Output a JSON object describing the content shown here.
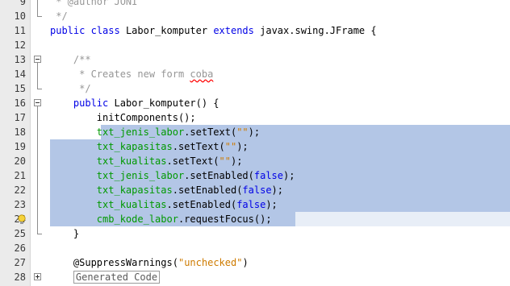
{
  "editor": {
    "line_numbers": [
      "9",
      "10",
      "11",
      "12",
      "13",
      "14",
      "15",
      "16",
      "17",
      "18",
      "19",
      "20",
      "21",
      "22",
      "23",
      "24",
      "25",
      "26",
      "27",
      "28"
    ],
    "lines": [
      [
        {
          "t": " * @author JONI",
          "c": "cmt"
        }
      ],
      [
        {
          "t": " */",
          "c": "cmt"
        }
      ],
      [
        {
          "t": "public",
          "c": "kw"
        },
        {
          "t": " ",
          "c": ""
        },
        {
          "t": "class",
          "c": "kw"
        },
        {
          "t": " Labor_komputer ",
          "c": ""
        },
        {
          "t": "extends",
          "c": "kw"
        },
        {
          "t": " javax.swing.JFrame {",
          "c": ""
        }
      ],
      [
        {
          "t": "",
          "c": ""
        }
      ],
      [
        {
          "t": "    /**",
          "c": "cmt"
        }
      ],
      [
        {
          "t": "     * Creates new form ",
          "c": "cmt"
        },
        {
          "t": "coba",
          "c": "cmt squiggle"
        }
      ],
      [
        {
          "t": "     */",
          "c": "cmt"
        }
      ],
      [
        {
          "t": "    ",
          "c": ""
        },
        {
          "t": "public",
          "c": "kw"
        },
        {
          "t": " Labor_komputer() {",
          "c": ""
        }
      ],
      [
        {
          "t": "        initComponents();",
          "c": ""
        }
      ],
      [
        {
          "t": "        ",
          "c": ""
        },
        {
          "t": "txt_jenis_labor",
          "c": "field"
        },
        {
          "t": ".setText(",
          "c": ""
        },
        {
          "t": "\"\"",
          "c": "str"
        },
        {
          "t": ");",
          "c": ""
        }
      ],
      [
        {
          "t": "        ",
          "c": ""
        },
        {
          "t": "txt_kapasitas",
          "c": "field"
        },
        {
          "t": ".setText(",
          "c": ""
        },
        {
          "t": "\"\"",
          "c": "str"
        },
        {
          "t": ");",
          "c": ""
        }
      ],
      [
        {
          "t": "        ",
          "c": ""
        },
        {
          "t": "txt_kualitas",
          "c": "field"
        },
        {
          "t": ".setText(",
          "c": ""
        },
        {
          "t": "\"\"",
          "c": "str"
        },
        {
          "t": ");",
          "c": ""
        }
      ],
      [
        {
          "t": "        ",
          "c": ""
        },
        {
          "t": "txt_jenis_labor",
          "c": "field"
        },
        {
          "t": ".setEnabled(",
          "c": ""
        },
        {
          "t": "false",
          "c": "kw"
        },
        {
          "t": ");",
          "c": ""
        }
      ],
      [
        {
          "t": "        ",
          "c": ""
        },
        {
          "t": "txt_kapasitas",
          "c": "field"
        },
        {
          "t": ".setEnabled(",
          "c": ""
        },
        {
          "t": "false",
          "c": "kw"
        },
        {
          "t": ");",
          "c": ""
        }
      ],
      [
        {
          "t": "        ",
          "c": ""
        },
        {
          "t": "txt_kualitas",
          "c": "field"
        },
        {
          "t": ".setEnabled(",
          "c": ""
        },
        {
          "t": "false",
          "c": "kw"
        },
        {
          "t": ");",
          "c": ""
        }
      ],
      [
        {
          "t": "        ",
          "c": ""
        },
        {
          "t": "cmb_kode_labor",
          "c": "field"
        },
        {
          "t": ".requestFocus();",
          "c": ""
        }
      ],
      [
        {
          "t": "    }",
          "c": ""
        }
      ],
      [
        {
          "t": "",
          "c": ""
        }
      ],
      [
        {
          "t": "    ",
          "c": ""
        },
        {
          "t": "@SuppressWarnings",
          "c": "anno"
        },
        {
          "t": "(",
          "c": ""
        },
        {
          "t": "\"unchecked\"",
          "c": "str"
        },
        {
          "t": ")",
          "c": ""
        }
      ],
      [
        {
          "t": "    ",
          "c": ""
        },
        {
          "t": "Generated Code",
          "c": "fold-placeholder"
        }
      ]
    ],
    "colors": {
      "selection": "#b3c6e6",
      "current_line": "#e8eef7",
      "keyword": "#0000e6",
      "string": "#ce7b00",
      "comment": "#969696",
      "field": "#009900",
      "gutter_bg": "#ebebeb"
    },
    "icons": {
      "fold_collapse": "minus-box-icon",
      "fold_expand": "plus-box-icon",
      "hint": "lightbulb-icon"
    }
  }
}
